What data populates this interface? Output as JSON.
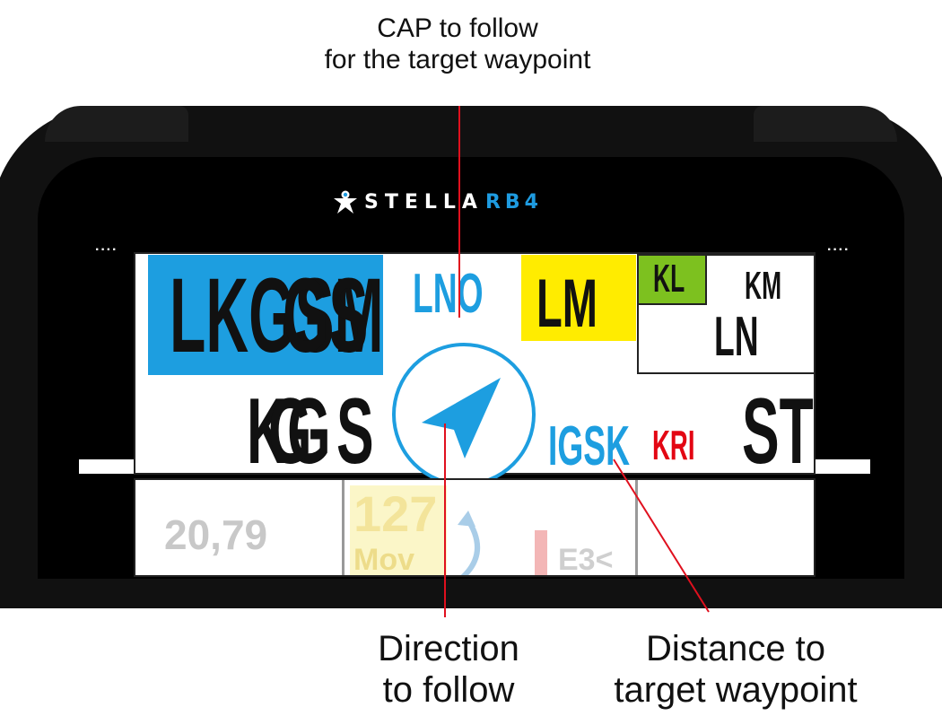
{
  "annotations": {
    "cap_line1": "CAP to follow",
    "cap_line2": "for the target waypoint",
    "direction_line1": "Direction",
    "direction_line2": "to follow",
    "distance_line1": "Distance to",
    "distance_line2": "target waypoint"
  },
  "device": {
    "brand_part1": "STELLA",
    "brand_part2": "RB4",
    "menu_dots_left": "····",
    "menu_dots_right": "····"
  },
  "display": {
    "top_left_value": "LKGSM",
    "top_left_overlay": "GS",
    "cap_value": "LNO",
    "yellow_value": "LM",
    "green_value": "KL",
    "box_value_top": "KM",
    "box_value_bottom": "LN",
    "mid_left_value": "KG",
    "mid_left_overlay": "G",
    "mid_left_suffix": "S",
    "distance_value": "IGSK",
    "red_value": "KRI",
    "right_value": "ST"
  },
  "lower_panel": {
    "value_1": "20,79",
    "value_2": "127",
    "value_2_label": "Mov",
    "value_3": "E3<"
  },
  "colors": {
    "accent_blue": "#1d9ee0",
    "yellow": "#ffec00",
    "green": "#7dc11f",
    "red": "#e30613",
    "callout_red": "#e0101e"
  },
  "icons": {
    "logo": "star-person-icon",
    "compass": "navigation-arrow-icon"
  }
}
